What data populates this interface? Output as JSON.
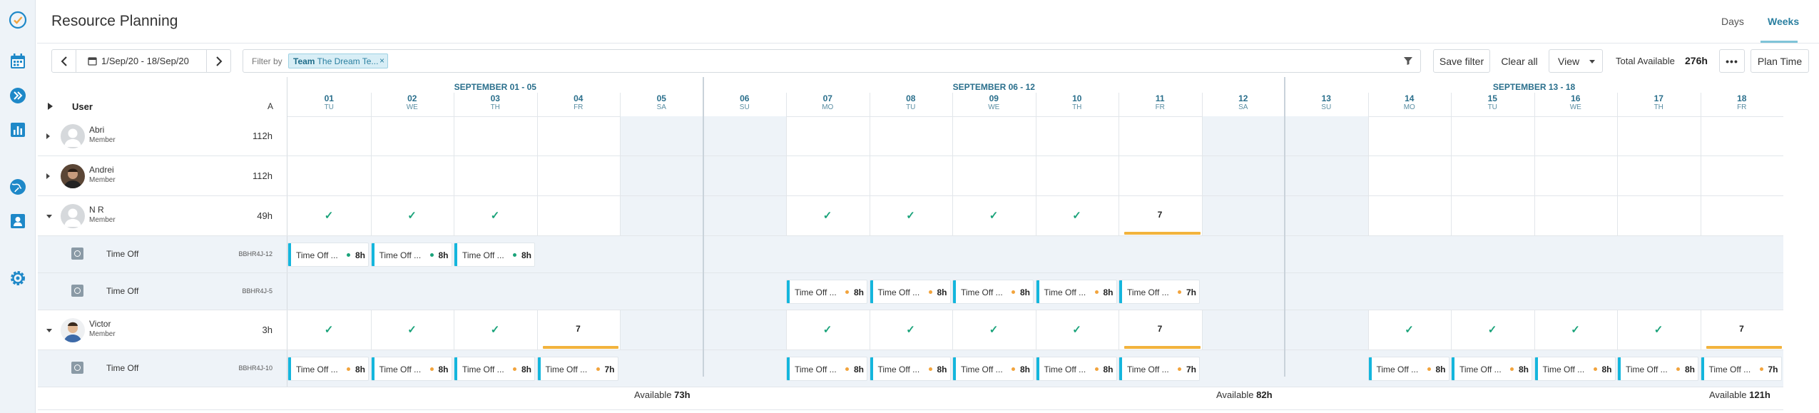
{
  "header": {
    "title": "Resource Planning",
    "view_tabs": {
      "days": "Days",
      "weeks": "Weeks",
      "active": "Weeks"
    }
  },
  "toolbar": {
    "date_range": "1/Sep/20 - 18/Sep/20",
    "filter_label": "Filter by",
    "filter_chip_key": "Team",
    "filter_chip_value": "The Dream Te...",
    "chip_close": "×",
    "save_filter": "Save filter",
    "clear_all": "Clear all",
    "view": "View",
    "total_available_label": "Total Available",
    "total_available_value": "276h",
    "more": "•••",
    "plan_time": "Plan Time"
  },
  "grid": {
    "user_header": "User",
    "a_header": "A",
    "weeks": [
      "SEPTEMBER 01 - 05",
      "SEPTEMBER 06 - 12",
      "SEPTEMBER 13 - 18"
    ],
    "days": [
      {
        "num": "01",
        "abbr": "TU"
      },
      {
        "num": "02",
        "abbr": "WE"
      },
      {
        "num": "03",
        "abbr": "TH"
      },
      {
        "num": "04",
        "abbr": "FR"
      },
      {
        "num": "05",
        "abbr": "SA"
      },
      {
        "num": "06",
        "abbr": "SU"
      },
      {
        "num": "07",
        "abbr": "MO"
      },
      {
        "num": "08",
        "abbr": "TU"
      },
      {
        "num": "09",
        "abbr": "WE"
      },
      {
        "num": "10",
        "abbr": "TH"
      },
      {
        "num": "11",
        "abbr": "FR"
      },
      {
        "num": "12",
        "abbr": "SA"
      },
      {
        "num": "13",
        "abbr": "SU"
      },
      {
        "num": "14",
        "abbr": "MO"
      },
      {
        "num": "15",
        "abbr": "TU"
      },
      {
        "num": "16",
        "abbr": "WE"
      },
      {
        "num": "17",
        "abbr": "TH"
      },
      {
        "num": "18",
        "abbr": "FR"
      }
    ],
    "weekend_days": [
      4,
      5,
      11,
      12
    ],
    "users": [
      {
        "name": "Abri",
        "role": "Member",
        "hours": "112h",
        "expanded": false,
        "avatar": "placeholder"
      },
      {
        "name": "Andrei",
        "role": "Member",
        "hours": "112h",
        "expanded": false,
        "avatar": "photo-dark"
      },
      {
        "name": "N R",
        "role": "Member",
        "hours": "49h",
        "expanded": true,
        "avatar": "placeholder",
        "day_marks": [
          "check",
          "check",
          "check",
          "",
          "",
          "",
          "check",
          "check",
          "check",
          "check",
          "7",
          "",
          "",
          "",
          "",
          "",
          "",
          ""
        ]
      },
      {
        "name": "Victor",
        "role": "Member",
        "hours": "3h",
        "expanded": true,
        "avatar": "photo-light",
        "day_marks": [
          "check",
          "check",
          "check",
          "7",
          "",
          "",
          "check",
          "check",
          "check",
          "check",
          "7",
          "",
          "",
          "check",
          "check",
          "check",
          "check",
          "7"
        ]
      }
    ],
    "timeoff_rows": [
      {
        "label": "Time Off",
        "code": "BBHR4J-12",
        "dot": "green",
        "events": [
          {
            "day": 0,
            "title": "Time Off ...",
            "hours": "8h"
          },
          {
            "day": 1,
            "title": "Time Off ...",
            "hours": "8h"
          },
          {
            "day": 2,
            "title": "Time Off ...",
            "hours": "8h"
          }
        ]
      },
      {
        "label": "Time Off",
        "code": "BBHR4J-5",
        "dot": "orange",
        "events": [
          {
            "day": 6,
            "title": "Time Off ...",
            "hours": "8h"
          },
          {
            "day": 7,
            "title": "Time Off ...",
            "hours": "8h"
          },
          {
            "day": 8,
            "title": "Time Off ...",
            "hours": "8h"
          },
          {
            "day": 9,
            "title": "Time Off ...",
            "hours": "8h"
          },
          {
            "day": 10,
            "title": "Time Off ...",
            "hours": "7h"
          }
        ]
      },
      {
        "label": "Time Off",
        "code": "BBHR4J-10",
        "dot": "orange",
        "events": [
          {
            "day": 0,
            "title": "Time Off ...",
            "hours": "8h"
          },
          {
            "day": 1,
            "title": "Time Off ...",
            "hours": "8h"
          },
          {
            "day": 2,
            "title": "Time Off ...",
            "hours": "8h"
          },
          {
            "day": 3,
            "title": "Time Off ...",
            "hours": "7h"
          },
          {
            "day": 6,
            "title": "Time Off ...",
            "hours": "8h"
          },
          {
            "day": 7,
            "title": "Time Off ...",
            "hours": "8h"
          },
          {
            "day": 8,
            "title": "Time Off ...",
            "hours": "8h"
          },
          {
            "day": 9,
            "title": "Time Off ...",
            "hours": "8h"
          },
          {
            "day": 10,
            "title": "Time Off ...",
            "hours": "7h"
          },
          {
            "day": 13,
            "title": "Time Off ...",
            "hours": "8h"
          },
          {
            "day": 14,
            "title": "Time Off ...",
            "hours": "8h"
          },
          {
            "day": 15,
            "title": "Time Off ...",
            "hours": "8h"
          },
          {
            "day": 16,
            "title": "Time Off ...",
            "hours": "8h"
          },
          {
            "day": 17,
            "title": "Time Off ...",
            "hours": "7h"
          }
        ]
      }
    ],
    "availability": [
      {
        "label": "Available",
        "value": "73h"
      },
      {
        "label": "Available",
        "value": "82h"
      },
      {
        "label": "Available",
        "value": "121h"
      }
    ]
  },
  "icons": {
    "nav": [
      "check-circle-icon",
      "calendar-icon",
      "chevron-double-right-icon",
      "bar-chart-icon",
      "globe-icon",
      "person-badge-icon",
      "gear-icon"
    ],
    "accent": "#14b6dd",
    "success": "#1aa37a",
    "warning": "#f2b33d"
  }
}
